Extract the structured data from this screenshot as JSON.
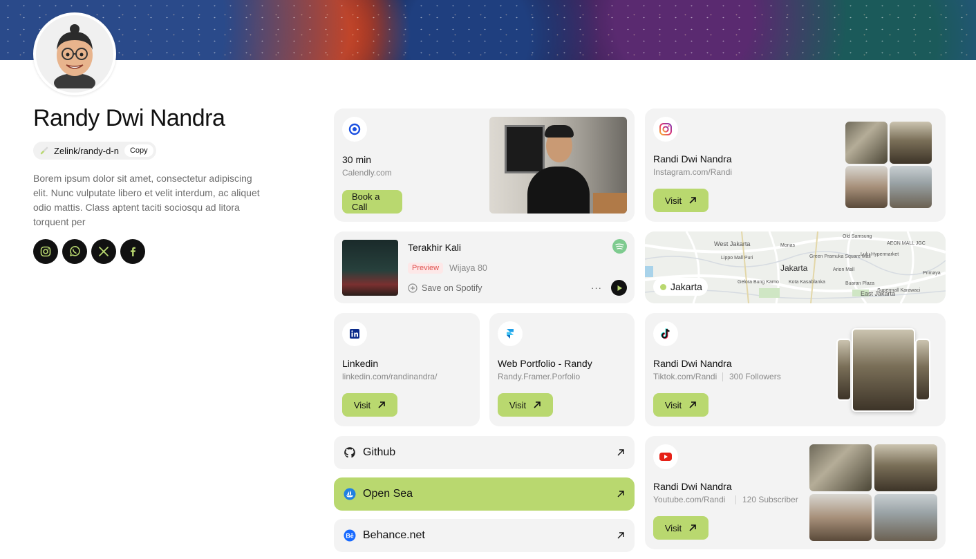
{
  "profile": {
    "name": "Randy Dwi Nandra",
    "handle": "Zelink/randy-d-n",
    "copy_label": "Copy",
    "bio": "Borem ipsum dolor sit amet, consectetur adipiscing elit. Nunc vulputate libero et velit interdum, ac aliquet odio mattis. Class aptent taciti sociosqu ad litora torquent per",
    "socials": [
      "instagram-icon",
      "whatsapp-icon",
      "x-icon",
      "facebook-icon"
    ]
  },
  "calendly": {
    "title": "30 min",
    "subtitle": "Calendly.com",
    "button": "Book a Call"
  },
  "instagram": {
    "title": "Randi Dwi Nandra",
    "subtitle": "Instagram.com/Randi",
    "button": "Visit"
  },
  "spotify": {
    "track": "Terakhir Kali",
    "badge": "Preview",
    "artist": "Wijaya 80",
    "save": "Save on Spotify",
    "more": "···"
  },
  "map": {
    "label": "Jakarta",
    "places": [
      "West Jakarta",
      "Jakarta",
      "East Jakarta",
      "Lippo Mall Puri",
      "Gelora Bung Karno",
      "Kota Kasablanka",
      "Monas",
      "Old Samsung",
      "AEON MALL JGC",
      "Green Pramuka Square Mall",
      "Lulu Hypermarket",
      "Arion Mall",
      "Buaran Plaza",
      "Primaya",
      "Supermall Karawaci"
    ]
  },
  "linkedin": {
    "title": "Linkedin",
    "subtitle": "linkedin.com/randinandra/",
    "button": "Visit"
  },
  "framer": {
    "title": "Web Portfolio - Randy",
    "subtitle": "Randy.Framer.Porfolio",
    "button": "Visit"
  },
  "tiktok": {
    "title": "Randi Dwi Nandra",
    "subtitle": "Tiktok.com/Randi",
    "followers": "300 Followers",
    "button": "Visit"
  },
  "links": [
    {
      "label": "Github"
    },
    {
      "label": "Open Sea"
    },
    {
      "label": "Behance.net"
    }
  ],
  "youtube": {
    "title": "Randi Dwi Nandra",
    "subtitle": "Youtube.com/Randi",
    "subscribers": "120 Subscriber",
    "button": "Visit"
  },
  "colors": {
    "accent": "#b9d86f",
    "card": "#f3f3f3",
    "text": "#111111",
    "muted": "#8a8a8a"
  }
}
